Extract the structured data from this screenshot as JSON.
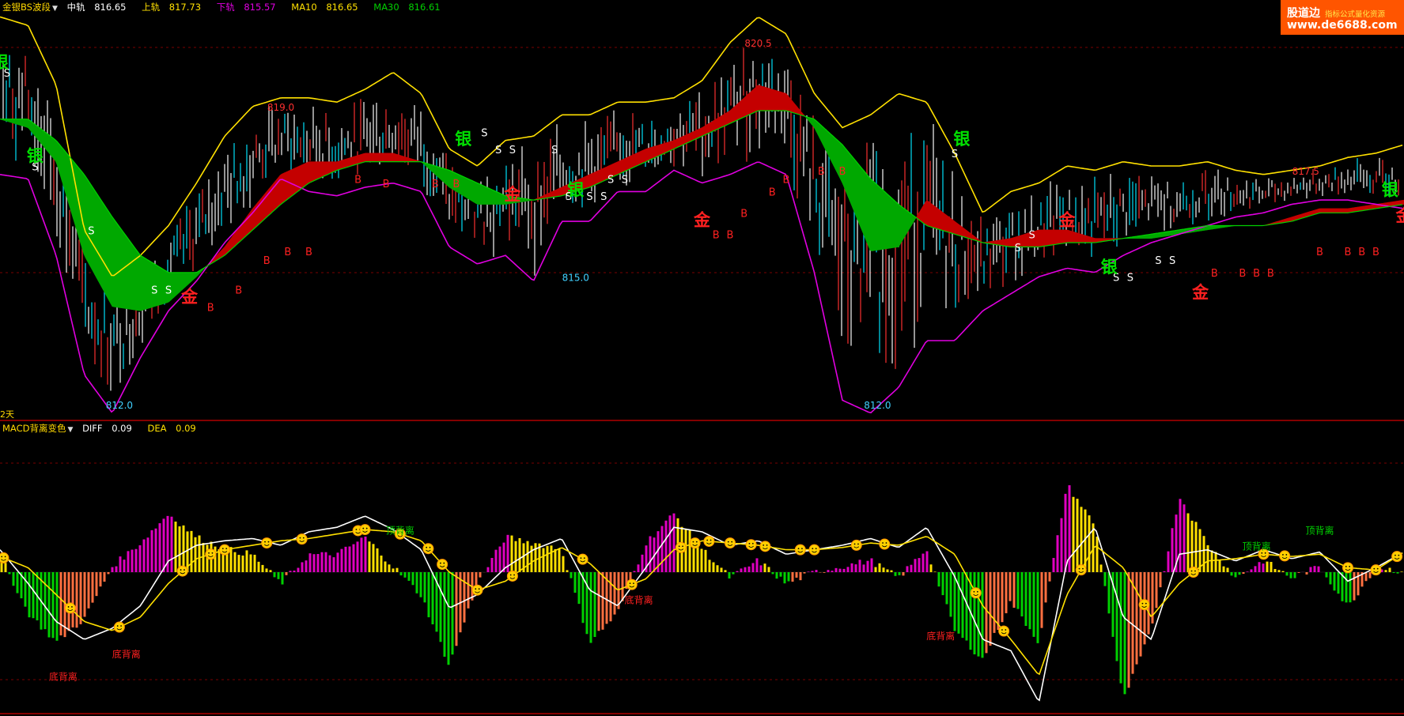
{
  "main_panel": {
    "indicator_name": "金银BS波段",
    "items": [
      {
        "label": "中轨",
        "value": "816.65",
        "color": "#ffffff"
      },
      {
        "label": "上轨",
        "value": "817.73",
        "color": "#ffe000"
      },
      {
        "label": "下轨",
        "value": "815.57",
        "color": "#e000e0"
      },
      {
        "label": "MA10",
        "value": "816.65",
        "color": "#ffe000"
      },
      {
        "label": "MA30",
        "value": "816.61",
        "color": "#00d000"
      }
    ]
  },
  "sub_panel": {
    "indicator_name": "MACD背离变色",
    "items": [
      {
        "label": "DIFF",
        "value": "0.09",
        "color": "#ffffff"
      },
      {
        "label": "DEA",
        "value": "0.09",
        "color": "#ffe000"
      }
    ]
  },
  "period_label": "2天",
  "watermark": {
    "brand": "股道边",
    "tagline": "指标公式量化资源",
    "url": "www.de6688.com"
  },
  "colors": {
    "upper": "#ffe000",
    "lower": "#e000e0",
    "bull_band": "#c40000",
    "bear_band": "#00a800",
    "candle_up": "#ff3030",
    "candle_down": "#00e5ff",
    "hist_pos": "#ffe000",
    "hist_pos2": "#e000c0",
    "hist_neg": "#00d000",
    "hist_neg2": "#ff7040"
  },
  "chart_data": [
    {
      "type": "line",
      "panel": "main",
      "price_labels": [
        {
          "text": "820.5",
          "x": 108,
          "y": 820.5
        },
        {
          "text": "819.0",
          "x": 40,
          "y": 819.0
        },
        {
          "text": "817.5",
          "x": 186,
          "y": 817.5
        },
        {
          "text": "815.0",
          "x": 82,
          "y": 815.0
        },
        {
          "text": "812.0",
          "x": 17,
          "y": 812.0
        },
        {
          "text": "812.0",
          "x": 125,
          "y": 812.0
        }
      ],
      "ylim": [
        811.8,
        821.3
      ],
      "x": [
        0,
        4,
        8,
        12,
        16,
        20,
        24,
        28,
        32,
        36,
        40,
        44,
        48,
        52,
        56,
        60,
        64,
        68,
        72,
        76,
        80,
        84,
        88,
        92,
        96,
        100,
        104,
        108,
        112,
        116,
        120,
        124,
        128,
        132,
        136,
        140,
        144,
        148,
        152,
        156,
        160,
        164,
        168,
        172,
        176,
        180,
        184,
        188,
        192,
        196,
        200
      ],
      "series": [
        {
          "name": "上轨",
          "values": [
            821.2,
            821.0,
            819.6,
            816.2,
            815.1,
            815.6,
            816.3,
            817.3,
            818.4,
            819.1,
            819.3,
            819.3,
            819.2,
            819.5,
            819.9,
            819.4,
            818.1,
            817.7,
            818.3,
            818.4,
            818.9,
            818.9,
            819.2,
            819.2,
            819.3,
            819.7,
            820.6,
            821.2,
            820.8,
            819.4,
            818.6,
            818.9,
            819.4,
            819.2,
            818.0,
            816.6,
            817.1,
            817.3,
            817.7,
            817.6,
            817.8,
            817.7,
            817.7,
            817.8,
            817.6,
            817.5,
            817.6,
            817.7,
            817.9,
            818.0,
            818.2
          ]
        },
        {
          "name": "下轨",
          "values": [
            817.5,
            817.4,
            815.6,
            812.8,
            811.9,
            813.2,
            814.3,
            815.0,
            815.9,
            816.6,
            817.4,
            817.1,
            817.0,
            817.2,
            817.3,
            817.1,
            815.8,
            815.4,
            815.6,
            815.0,
            816.4,
            816.4,
            817.1,
            817.1,
            817.6,
            817.3,
            817.5,
            817.8,
            817.5,
            815.2,
            812.2,
            811.9,
            812.5,
            813.6,
            813.6,
            814.3,
            814.7,
            815.1,
            815.3,
            815.2,
            815.6,
            815.9,
            816.1,
            816.3,
            816.5,
            816.6,
            816.8,
            816.9,
            816.9,
            816.8,
            816.7
          ]
        },
        {
          "name": "MA10",
          "values": [
            818.8,
            818.6,
            817.8,
            815.6,
            814.4,
            814.3,
            814.5,
            815.1,
            815.8,
            816.7,
            817.5,
            817.8,
            817.8,
            818.0,
            818.0,
            817.8,
            817.2,
            816.8,
            816.8,
            816.9,
            817.2,
            817.5,
            817.8,
            818.1,
            818.3,
            818.6,
            819.0,
            819.6,
            819.4,
            818.6,
            817.3,
            815.7,
            815.8,
            816.9,
            816.4,
            815.9,
            816.0,
            816.2,
            816.2,
            816.0,
            816.0,
            816.0,
            816.1,
            816.2,
            816.3,
            816.3,
            816.5,
            816.7,
            816.7,
            816.8,
            816.9
          ]
        },
        {
          "name": "MA30",
          "values": [
            818.8,
            818.8,
            818.3,
            817.5,
            816.5,
            815.6,
            815.2,
            815.2,
            815.6,
            816.2,
            816.8,
            817.3,
            817.6,
            817.8,
            817.8,
            817.8,
            817.6,
            817.3,
            817.0,
            816.9,
            817.0,
            817.2,
            817.5,
            817.8,
            818.1,
            818.4,
            818.7,
            819.0,
            819.0,
            818.8,
            818.2,
            817.4,
            816.8,
            816.3,
            816.1,
            815.9,
            815.8,
            815.8,
            815.9,
            815.9,
            816.0,
            816.1,
            816.2,
            816.3,
            816.3,
            816.3,
            816.4,
            816.6,
            816.6,
            816.7,
            816.8
          ]
        }
      ],
      "signals": [
        {
          "text": "S",
          "x": 1,
          "y": 819.8
        },
        {
          "text": "S",
          "x": 5,
          "y": 817.6
        },
        {
          "text": "S",
          "x": 13,
          "y": 816.1
        },
        {
          "text": "S",
          "x": 22,
          "y": 814.7
        },
        {
          "text": "S",
          "x": 24,
          "y": 814.7
        },
        {
          "text": "B",
          "x": 30,
          "y": 814.3
        },
        {
          "text": "B",
          "x": 34,
          "y": 814.7
        },
        {
          "text": "B",
          "x": 38,
          "y": 815.4
        },
        {
          "text": "B",
          "x": 41,
          "y": 815.6
        },
        {
          "text": "B",
          "x": 44,
          "y": 815.6
        },
        {
          "text": "B",
          "x": 51,
          "y": 817.3
        },
        {
          "text": "B",
          "x": 55,
          "y": 817.2
        },
        {
          "text": "B",
          "x": 62,
          "y": 817.2
        },
        {
          "text": "B",
          "x": 65,
          "y": 817.2
        },
        {
          "text": "S",
          "x": 69,
          "y": 818.4
        },
        {
          "text": "S",
          "x": 71,
          "y": 818.0
        },
        {
          "text": "S",
          "x": 73,
          "y": 818.0
        },
        {
          "text": "S",
          "x": 79,
          "y": 818.0
        },
        {
          "text": "S",
          "x": 81,
          "y": 816.9
        },
        {
          "text": "S",
          "x": 84,
          "y": 816.9
        },
        {
          "text": "S",
          "x": 86,
          "y": 816.9
        },
        {
          "text": "S",
          "x": 87,
          "y": 817.3
        },
        {
          "text": "S",
          "x": 89,
          "y": 817.3
        },
        {
          "text": "B",
          "x": 102,
          "y": 816.0
        },
        {
          "text": "B",
          "x": 104,
          "y": 816.0
        },
        {
          "text": "B",
          "x": 106,
          "y": 816.5
        },
        {
          "text": "B",
          "x": 110,
          "y": 817.0
        },
        {
          "text": "B",
          "x": 112,
          "y": 817.3
        },
        {
          "text": "B",
          "x": 117,
          "y": 817.5
        },
        {
          "text": "B",
          "x": 120,
          "y": 817.5
        },
        {
          "text": "S",
          "x": 136,
          "y": 817.9
        },
        {
          "text": "S",
          "x": 145,
          "y": 815.7
        },
        {
          "text": "S",
          "x": 147,
          "y": 816.0
        },
        {
          "text": "S",
          "x": 159,
          "y": 815.0
        },
        {
          "text": "S",
          "x": 161,
          "y": 815.0
        },
        {
          "text": "S",
          "x": 165,
          "y": 815.4
        },
        {
          "text": "S",
          "x": 167,
          "y": 815.4
        },
        {
          "text": "B",
          "x": 173,
          "y": 815.1
        },
        {
          "text": "B",
          "x": 177,
          "y": 815.1
        },
        {
          "text": "B",
          "x": 179,
          "y": 815.1
        },
        {
          "text": "B",
          "x": 181,
          "y": 815.1
        },
        {
          "text": "B",
          "x": 188,
          "y": 815.6
        },
        {
          "text": "B",
          "x": 192,
          "y": 815.6
        },
        {
          "text": "B",
          "x": 194,
          "y": 815.6
        },
        {
          "text": "B",
          "x": 196,
          "y": 815.6
        }
      ],
      "big_glyphs": [
        {
          "text": "银",
          "x": 0,
          "y": 820.0,
          "color": "#00e000"
        },
        {
          "text": "银",
          "x": 5,
          "y": 817.8,
          "color": "#00e000"
        },
        {
          "text": "金",
          "x": 27,
          "y": 814.5,
          "color": "#ff2020"
        },
        {
          "text": "银",
          "x": 66,
          "y": 818.2,
          "color": "#00e000"
        },
        {
          "text": "金",
          "x": 73,
          "y": 816.9,
          "color": "#ff2020"
        },
        {
          "text": "银",
          "x": 82,
          "y": 817.0,
          "color": "#00e000"
        },
        {
          "text": "金",
          "x": 100,
          "y": 816.3,
          "color": "#ff2020"
        },
        {
          "text": "银",
          "x": 137,
          "y": 818.2,
          "color": "#00e000"
        },
        {
          "text": "金",
          "x": 152,
          "y": 816.3,
          "color": "#ff2020"
        },
        {
          "text": "银",
          "x": 158,
          "y": 815.2,
          "color": "#00e000"
        },
        {
          "text": "金",
          "x": 171,
          "y": 814.6,
          "color": "#ff2020"
        },
        {
          "text": "银",
          "x": 198,
          "y": 817.0,
          "color": "#00e000"
        },
        {
          "text": "金",
          "x": 200,
          "y": 816.4,
          "color": "#ff2020"
        }
      ]
    },
    {
      "type": "bar",
      "panel": "sub",
      "ylim": [
        -0.62,
        0.62
      ],
      "x": [
        0,
        4,
        8,
        12,
        16,
        20,
        24,
        28,
        32,
        36,
        40,
        44,
        48,
        52,
        56,
        60,
        64,
        68,
        72,
        76,
        80,
        84,
        88,
        92,
        96,
        100,
        104,
        108,
        112,
        116,
        120,
        124,
        128,
        132,
        136,
        140,
        144,
        148,
        152,
        156,
        160,
        164,
        168,
        172,
        176,
        180,
        184,
        188,
        192,
        196,
        200
      ],
      "series": [
        {
          "name": "DIFF",
          "values": [
            0.1,
            -0.05,
            -0.22,
            -0.3,
            -0.25,
            -0.15,
            0.05,
            0.12,
            0.14,
            0.15,
            0.12,
            0.18,
            0.2,
            0.25,
            0.19,
            0.1,
            -0.16,
            -0.1,
            0.02,
            0.1,
            0.15,
            -0.08,
            -0.15,
            0.02,
            0.2,
            0.18,
            0.12,
            0.14,
            0.08,
            0.1,
            0.12,
            0.15,
            0.11,
            0.2,
            -0.02,
            -0.3,
            -0.35,
            -0.58,
            0.05,
            0.2,
            -0.2,
            -0.3,
            0.08,
            0.1,
            0.05,
            0.1,
            0.06,
            0.09,
            -0.04,
            0.02,
            0.09
          ]
        },
        {
          "name": "DEA",
          "values": [
            0.07,
            0.02,
            -0.1,
            -0.22,
            -0.26,
            -0.2,
            -0.05,
            0.06,
            0.1,
            0.12,
            0.14,
            0.15,
            0.17,
            0.19,
            0.18,
            0.14,
            0.0,
            -0.08,
            -0.04,
            0.05,
            0.11,
            0.04,
            -0.08,
            -0.03,
            0.1,
            0.14,
            0.13,
            0.12,
            0.1,
            0.1,
            0.11,
            0.13,
            0.12,
            0.16,
            0.08,
            -0.15,
            -0.3,
            -0.46,
            -0.1,
            0.12,
            0.02,
            -0.2,
            -0.05,
            0.05,
            0.06,
            0.08,
            0.07,
            0.08,
            0.02,
            0.01,
            0.09
          ]
        }
      ],
      "divergence_labels": [
        {
          "text": "底背离",
          "x": 9,
          "y": -0.48,
          "color": "#ff2020"
        },
        {
          "text": "底背离",
          "x": 18,
          "y": -0.38,
          "color": "#ff2020"
        },
        {
          "text": "顶背离",
          "x": 57,
          "y": 0.17,
          "color": "#00d000"
        },
        {
          "text": "底背离",
          "x": 91,
          "y": -0.14,
          "color": "#ff2020"
        },
        {
          "text": "底背离",
          "x": 134,
          "y": -0.3,
          "color": "#ff2020"
        },
        {
          "text": "顶背离",
          "x": 179,
          "y": 0.1,
          "color": "#00d000"
        },
        {
          "text": "顶背离",
          "x": 188,
          "y": 0.17,
          "color": "#00d000"
        }
      ]
    }
  ]
}
